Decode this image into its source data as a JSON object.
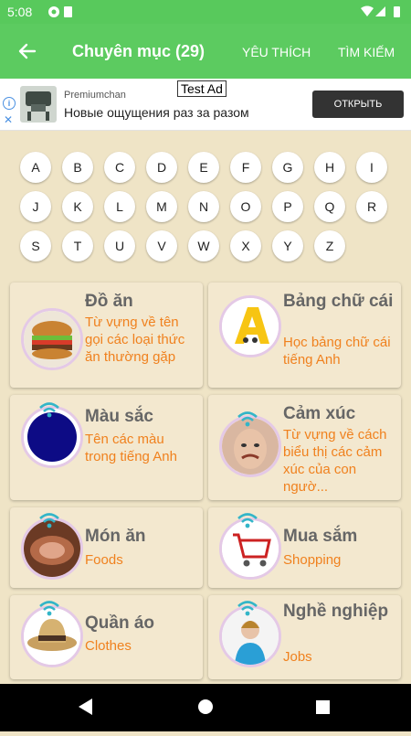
{
  "status": {
    "time": "5:08"
  },
  "appbar": {
    "title": "Chuyên mục (29)",
    "tab_favorites": "YÊU THÍCH",
    "tab_search": "TÌM KIẾM"
  },
  "ad": {
    "advertiser": "Premiumchan",
    "headline": "Новые ощущения раз за разом",
    "label": "Test Ad",
    "cta": "ОТКРЫТЬ"
  },
  "alphabet": [
    "A",
    "B",
    "C",
    "D",
    "E",
    "F",
    "G",
    "H",
    "I",
    "J",
    "K",
    "L",
    "M",
    "N",
    "O",
    "P",
    "Q",
    "R",
    "S",
    "T",
    "U",
    "V",
    "W",
    "X",
    "Y",
    "Z"
  ],
  "categories": [
    {
      "title": "Đồ ăn",
      "subtitle": "Từ vựng về tên gọi các loại thức ăn thường gặp",
      "icon": "burger-icon"
    },
    {
      "title": "Bảng chữ cái",
      "subtitle": "Học bảng chữ cái tiếng Anh",
      "icon": "letter-a-icon"
    },
    {
      "title": "Màu sắc",
      "subtitle": "Tên các màu trong tiếng Anh",
      "icon": "color-blob-icon"
    },
    {
      "title": "Cảm xúc",
      "subtitle": "Từ vựng về cách biểu thị các cảm xúc của con ngườ...",
      "icon": "face-icon"
    },
    {
      "title": "Món ăn",
      "subtitle": "Foods",
      "icon": "meat-dish-icon"
    },
    {
      "title": "Mua sắm",
      "subtitle": "Shopping",
      "icon": "shopping-cart-icon"
    },
    {
      "title": "Quần áo",
      "subtitle": "Clothes",
      "icon": "hat-icon"
    },
    {
      "title": "Nghề nghiệp",
      "subtitle": "Jobs",
      "icon": "person-icon"
    }
  ],
  "colors": {
    "appbar": "#5ccb60",
    "background": "#efe4c6",
    "subtitle": "#f0811e"
  }
}
